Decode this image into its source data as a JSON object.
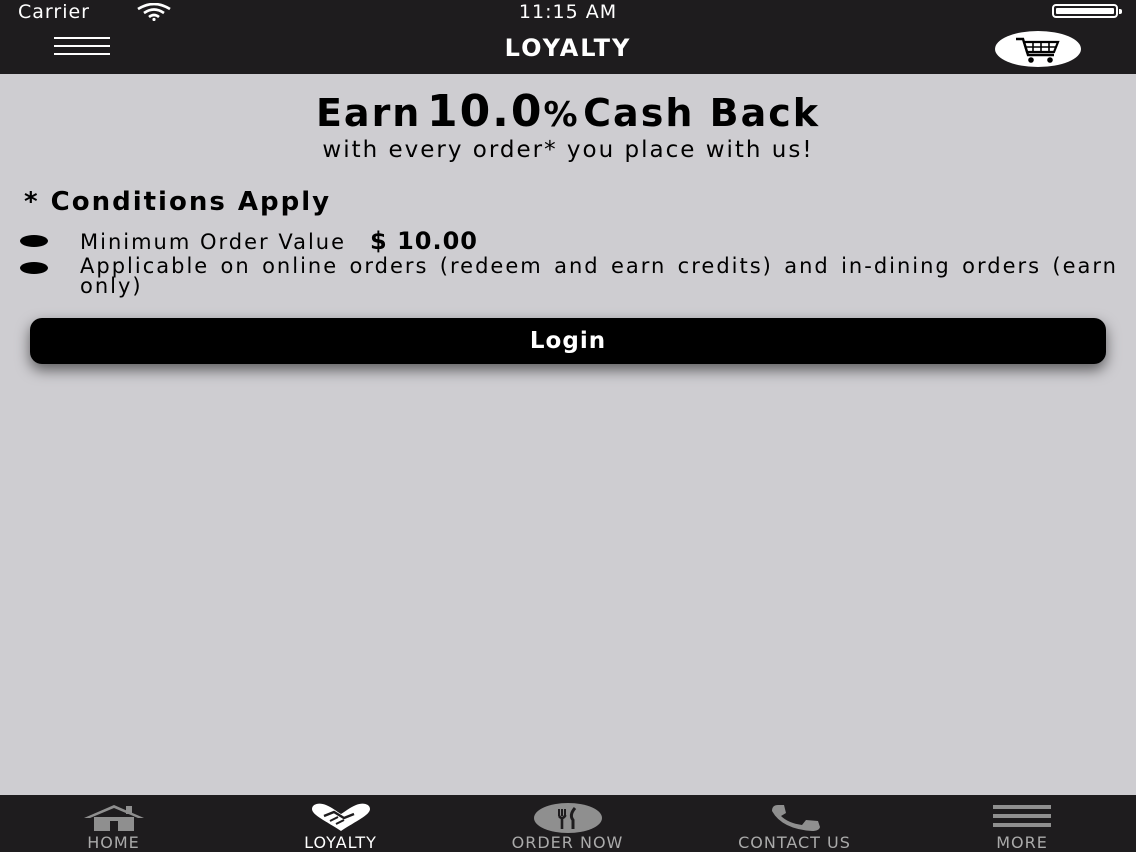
{
  "status_bar": {
    "carrier": "Carrier",
    "time": "11:15 AM"
  },
  "nav": {
    "title": "LOYALTY",
    "menu_icon": "hamburger-menu-icon",
    "cart_icon": "shopping-cart-icon"
  },
  "promo": {
    "earn": "Earn",
    "percent_value": "10.0",
    "percent_sign": "%",
    "cash_back": "Cash Back",
    "subline": "with every order* you place with us!"
  },
  "conditions": {
    "title": "* Conditions Apply",
    "items": [
      {
        "text": "Minimum Order Value",
        "value": "$ 10.00"
      },
      {
        "text": "Applicable on online orders (redeem and earn credits) and in-dining orders (earn only)"
      }
    ]
  },
  "login_button": {
    "label": "Login"
  },
  "tabs": [
    {
      "label": "HOME",
      "icon": "home-icon",
      "active": false
    },
    {
      "label": "LOYALTY",
      "icon": "handshake-heart-icon",
      "active": true
    },
    {
      "label": "ORDER NOW",
      "icon": "utensils-icon",
      "active": false
    },
    {
      "label": "CONTACT US",
      "icon": "phone-icon",
      "active": false
    },
    {
      "label": "MORE",
      "icon": "more-menu-icon",
      "active": false
    }
  ],
  "colors": {
    "background": "#cecdd1",
    "bar": "#1e1c1e",
    "button": "#000000",
    "inactive_tab": "#aaaaaa",
    "active_tab": "#ffffff"
  }
}
